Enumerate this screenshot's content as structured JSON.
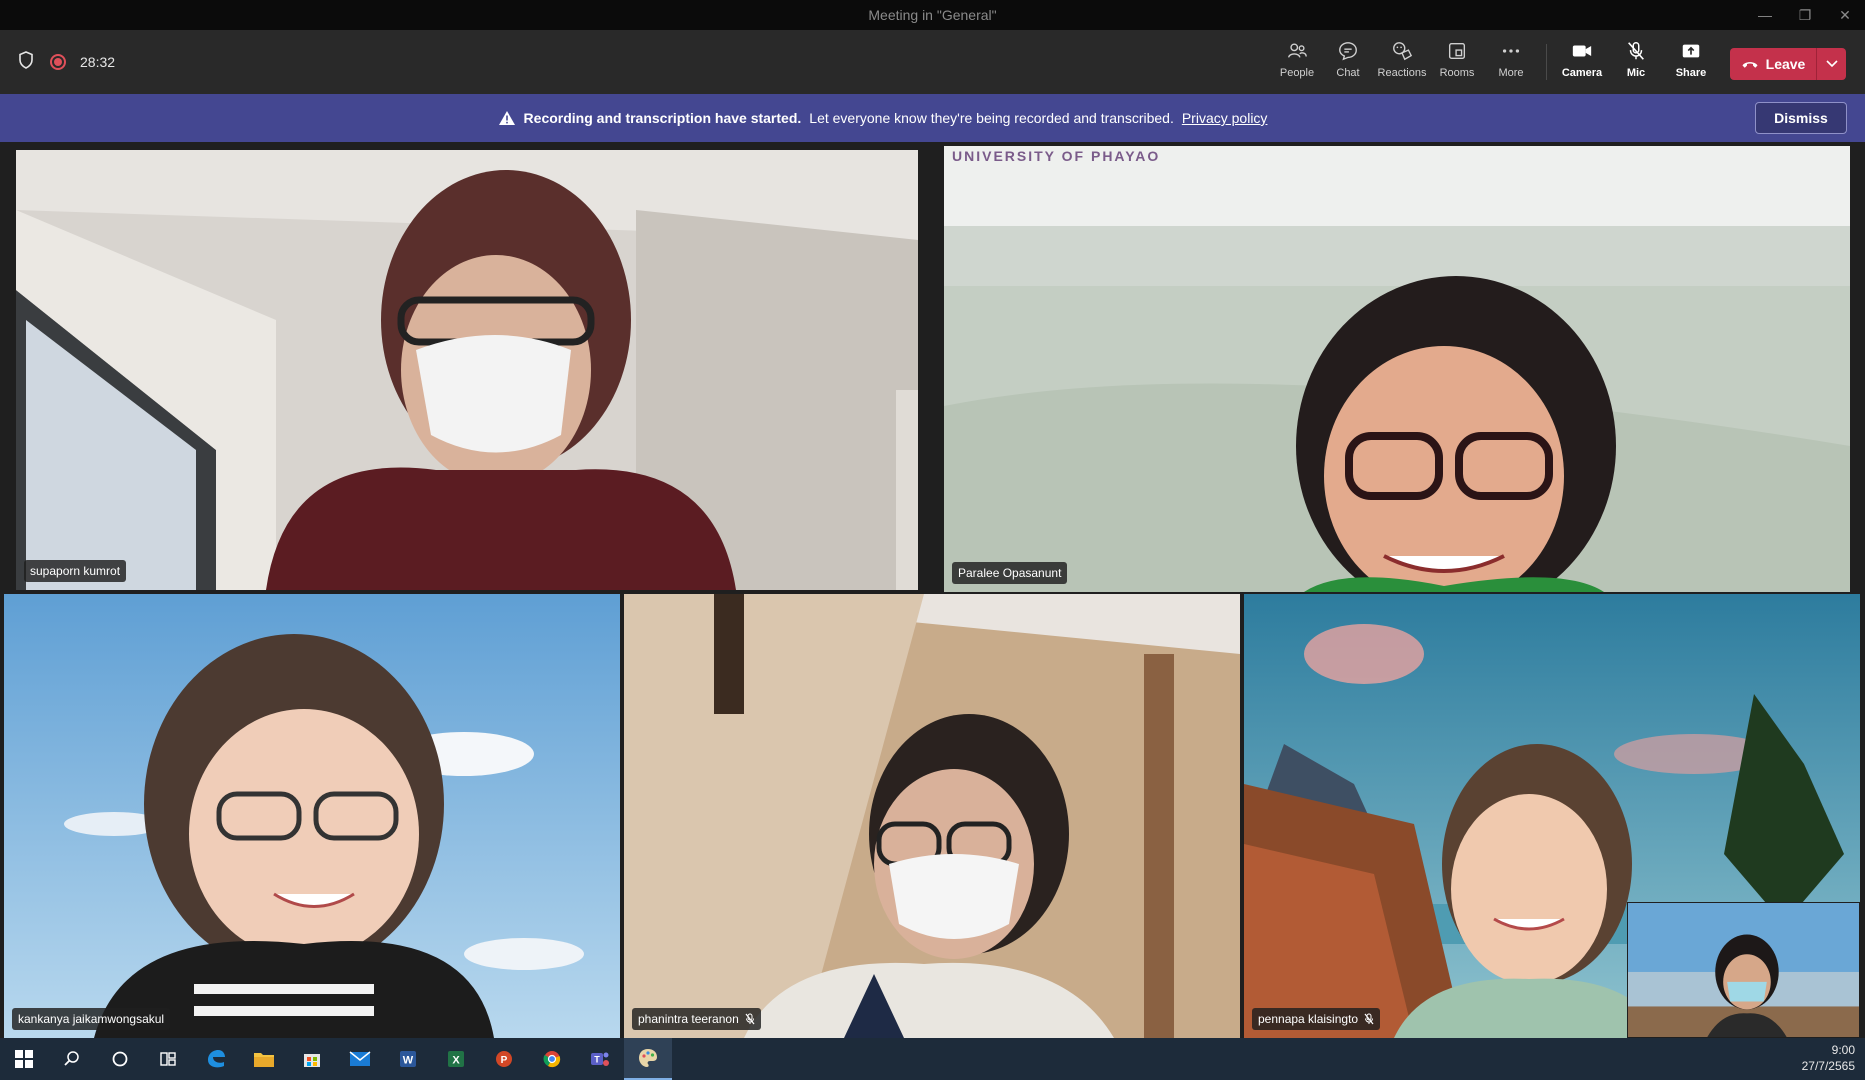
{
  "window": {
    "title": "Meeting in \"General\"",
    "controls": [
      "—",
      "❐",
      "✕"
    ]
  },
  "toolbar": {
    "timer": "28:32",
    "buttons": {
      "people": "People",
      "chat": "Chat",
      "reactions": "Reactions",
      "rooms": "Rooms",
      "more": "More",
      "camera": "Camera",
      "mic": "Mic",
      "share": "Share"
    },
    "leave": "Leave"
  },
  "banner": {
    "bold": "Recording and transcription have started.",
    "text": "Let everyone know they're being recorded and transcribed.",
    "link": "Privacy policy",
    "dismiss": "Dismiss"
  },
  "participants": [
    {
      "name": "supaporn kumrot",
      "muted": false,
      "active": true
    },
    {
      "name": "Paralee Opasanunt",
      "muted": false,
      "active": false
    },
    {
      "name": "kankanya jaikamwongsakul",
      "muted": false,
      "active": false
    },
    {
      "name": "phanintra teeranon",
      "muted": true,
      "active": false
    },
    {
      "name": "pennapa klaisingto",
      "muted": true,
      "active": false
    }
  ],
  "background_text": "UNIVERSITY OF PHAYAO",
  "taskbar": {
    "time": "9:00",
    "date": "27/7/2565"
  },
  "colors": {
    "accent": "#444791",
    "leave": "#c4314b",
    "active_outline": "#7f85f5"
  }
}
